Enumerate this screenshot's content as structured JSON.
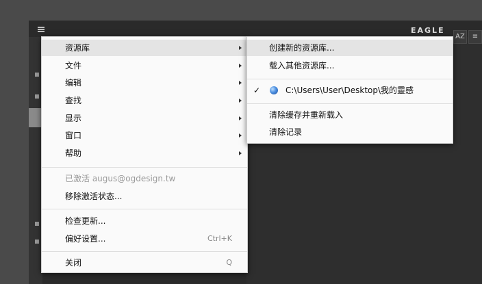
{
  "app": {
    "title": "EAGLE",
    "toolbar": {
      "sort_label": "AZ",
      "filter_label": "≡"
    }
  },
  "main_menu": {
    "items": [
      {
        "label": "资源库",
        "has_submenu": true,
        "active": true
      },
      {
        "label": "文件",
        "has_submenu": true
      },
      {
        "label": "编辑",
        "has_submenu": true
      },
      {
        "label": "查找",
        "has_submenu": true
      },
      {
        "label": "显示",
        "has_submenu": true
      },
      {
        "label": "窗口",
        "has_submenu": true
      },
      {
        "label": "帮助",
        "has_submenu": true
      }
    ],
    "account": {
      "activated_label": "已激活 augus@ogdesign.tw",
      "remove_activation_label": "移除激活状态..."
    },
    "check_update_label": "检查更新...",
    "preferences_label": "偏好设置...",
    "preferences_shortcut": "Ctrl+K",
    "close_label": "关闭",
    "close_shortcut": "Q"
  },
  "library_submenu": {
    "create_label": "创建新的资源库...",
    "load_other_label": "载入其他资源库...",
    "current_library": {
      "checked": true,
      "icon": "globe-icon",
      "path": "C:\\Users\\User\\Desktop\\我的靈感"
    },
    "clear_cache_label": "清除缓存并重新载入",
    "clear_history_label": "清除记录"
  }
}
